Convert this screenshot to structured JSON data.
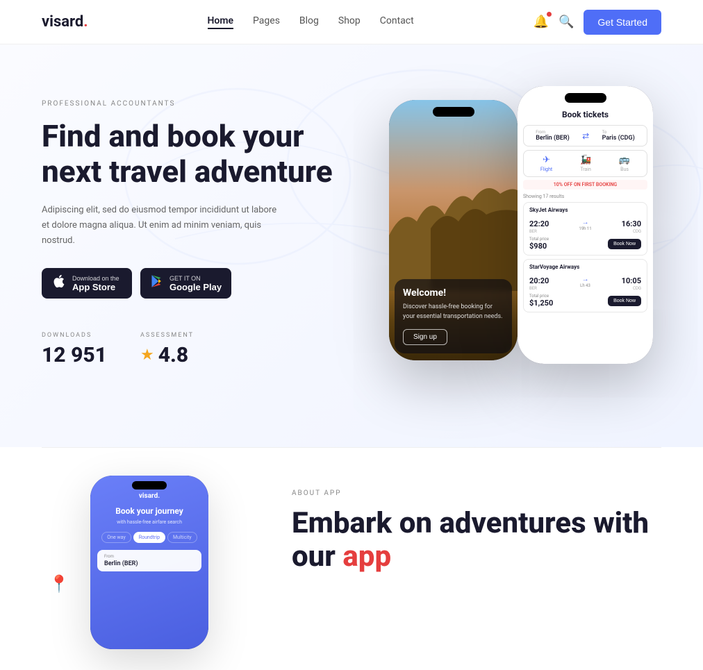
{
  "brand": {
    "name": "visard",
    "dot": "."
  },
  "nav": {
    "links": [
      {
        "label": "Home",
        "active": true
      },
      {
        "label": "Pages",
        "active": false
      },
      {
        "label": "Blog",
        "active": false
      },
      {
        "label": "Shop",
        "active": false
      },
      {
        "label": "Contact",
        "active": false
      }
    ],
    "cta_label": "Get Started"
  },
  "hero": {
    "tag": "Professional Accountants",
    "title": "Find and book your next travel adventure",
    "description": "Adipiscing elit, sed do eiusmod tempor incididunt ut labore et dolore magna aliqua. Ut enim ad minim veniam, quis nostrud.",
    "app_store": {
      "small": "Download on the",
      "big": "App Store"
    },
    "google_play": {
      "small": "GET IT ON",
      "big": "Google Play"
    },
    "stats": {
      "downloads_label": "Downloads",
      "downloads_value": "12 951",
      "assessment_label": "Assessment",
      "assessment_value": "4.8"
    }
  },
  "phone1": {
    "welcome_title": "Welcome!",
    "welcome_desc": "Discover hassle-free booking for your essential transportation needs.",
    "signup_btn": "Sign up"
  },
  "phone2": {
    "title": "Book tickets",
    "from": "Berlin (BER)",
    "to": "Paris (CDG)",
    "transport": [
      "Flight",
      "Train",
      "Bus"
    ],
    "discount": "10% OFF ON FIRST BOOKING",
    "results": "Showing 17 results",
    "flights": [
      {
        "airline": "SkyJet Airways",
        "depart": "22:20",
        "arrive": "16:30",
        "depart_code": "BER",
        "arrive_code": "CDG",
        "duration": "19h 11",
        "price_label": "Total price",
        "price": "$980",
        "btn": "Book Now"
      },
      {
        "airline": "StarVoyage Airways",
        "depart": "20:20",
        "arrive": "10:05",
        "depart_code": "BER",
        "arrive_code": "CDG",
        "duration": "Lh 43",
        "price_label": "Total price",
        "price": "$1,250",
        "btn": "Book Now"
      }
    ]
  },
  "phone3": {
    "logo": "visard.",
    "title": "Book your journey",
    "subtitle": "with hassle-free airfare search",
    "tabs": [
      "One way",
      "Roundtrip",
      "Multicity"
    ],
    "search_label": "From",
    "search_value": "Berlin (BER)"
  },
  "about": {
    "tag": "About App",
    "title_start": "Embark on adventures with our ",
    "title_highlight": "app"
  }
}
